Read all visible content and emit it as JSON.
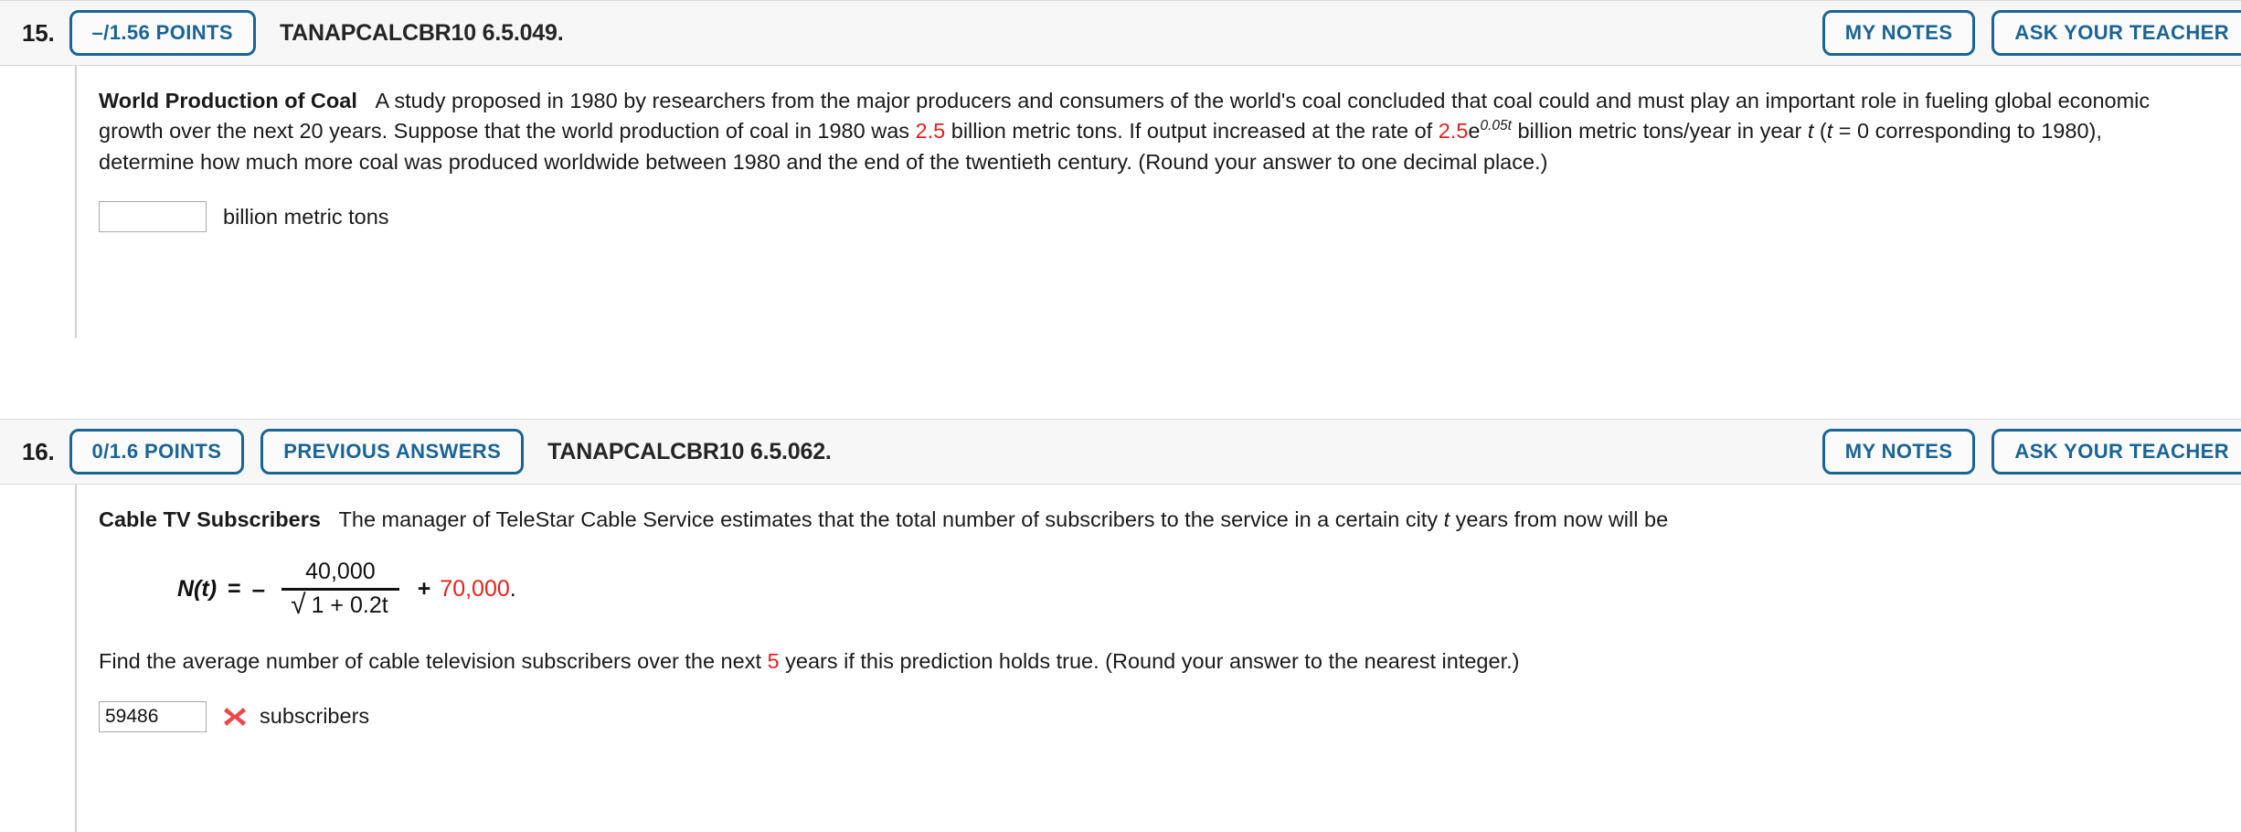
{
  "questions": [
    {
      "number": "15.",
      "points_label": "–/1.56 POINTS",
      "code": "TANAPCALCBR10 6.5.049.",
      "my_notes_label": "MY NOTES",
      "ask_teacher_label": "ASK YOUR TEACHER",
      "topic": "World Production of Coal",
      "text_1": "A study proposed in 1980 by researchers from the major producers and consumers of the world's coal concluded that coal could and must play an important role in fueling global economic growth over the next 20 years. Suppose that the world production of coal in 1980 was ",
      "value_1": "2.5",
      "text_2": " billion metric tons. If output increased at the rate of ",
      "value_2": "2.5",
      "expr_base": "e",
      "expr_exponent": "0.05t",
      "text_3": " billion metric tons/year in year ",
      "var_t": "t",
      "text_4": " (",
      "var_t2": "t",
      "text_5": " = 0 corresponding to 1980), determine how much more coal was produced worldwide between 1980 and the end of the twentieth century. (Round your answer to one decimal place.)",
      "answer_value": "",
      "answer_unit": "billion metric tons"
    },
    {
      "number": "16.",
      "points_label": "0/1.6 POINTS",
      "previous_answers_label": "PREVIOUS ANSWERS",
      "code": "TANAPCALCBR10 6.5.062.",
      "my_notes_label": "MY NOTES",
      "ask_teacher_label": "ASK YOUR TEACHER",
      "topic": "Cable TV Subscribers",
      "text_1": "The manager of TeleStar Cable Service estimates that the total number of subscribers to the service in a certain city ",
      "var_t": "t",
      "text_2": " years from now will be",
      "formula": {
        "lhs": "N(t)",
        "equals": "=",
        "minus": "–",
        "numerator": "40,000",
        "radical_sign": "√",
        "denominator": "1 + 0.2t",
        "plus": "+",
        "constant": "70,000",
        "period": "."
      },
      "text_3": "Find the average number of cable television subscribers over the next ",
      "value_years": "5",
      "text_4": " years if this prediction holds true. (Round your answer to the nearest integer.)",
      "answer_value": "59486",
      "answer_unit": "subscribers",
      "answer_status": "incorrect"
    }
  ],
  "colors": {
    "accent_blue": "#1a6496",
    "highlight_red": "#e8201e",
    "incorrect_x": "#ef4747",
    "header_bg": "#f7f7f7"
  }
}
